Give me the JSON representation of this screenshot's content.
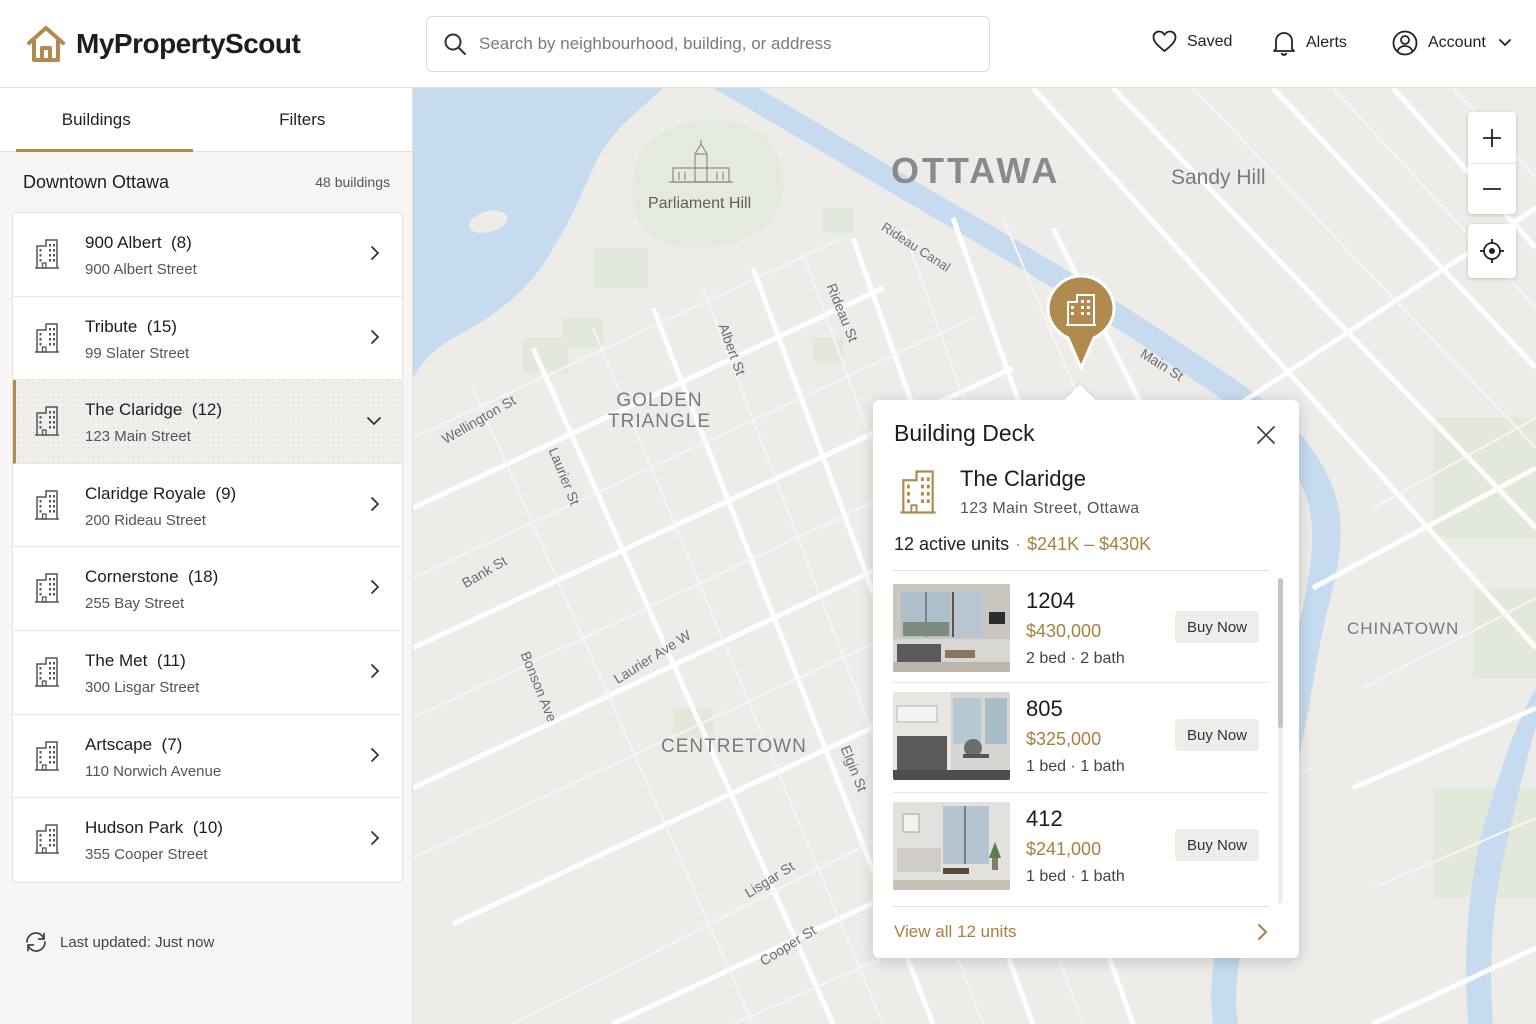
{
  "header": {
    "brand": "MyPropertyScout",
    "search_placeholder": "Search by neighbourhood, building, or address",
    "saved_label": "Saved",
    "alerts_label": "Alerts",
    "account_label": "Account"
  },
  "sidebar": {
    "tabs": [
      {
        "label": "Buildings",
        "active": true
      },
      {
        "label": "Filters",
        "active": false
      }
    ],
    "area": "Downtown Ottawa",
    "count": "48 buildings",
    "buildings": [
      {
        "name": "900 Albert",
        "units": "(8)",
        "address": "900 Albert Street"
      },
      {
        "name": "Tribute",
        "units": "(15)",
        "address": "99 Slater Street"
      },
      {
        "name": "The Claridge",
        "units": "(12)",
        "address": "123 Main Street"
      },
      {
        "name": "Claridge Royale",
        "units": "(9)",
        "address": "200 Rideau Street"
      },
      {
        "name": "Cornerstone",
        "units": "(18)",
        "address": "255 Bay Street"
      },
      {
        "name": "The Met",
        "units": "(11)",
        "address": "300 Lisgar Street"
      },
      {
        "name": "Artscape",
        "units": "(7)",
        "address": "110 Norwich Avenue"
      },
      {
        "name": "Hudson Park",
        "units": "(10)",
        "address": "355 Cooper Street"
      }
    ],
    "last_updated": "Last updated: Just now"
  },
  "map": {
    "city": "OTTAWA",
    "labels": {
      "sandy_hill": "Sandy Hill",
      "parliament": "Parliament Hill",
      "golden_triangle": "GOLDEN\nTRIANGLE",
      "centretown": "CENTRETOWN",
      "chinatown": "CHINATOWN",
      "rideau_canal": "Rideau Canal",
      "rideau_st": "Rideau St",
      "albert_st": "Albert St",
      "main_st": "Main St",
      "wellington_st": "Wellington St",
      "laurier_st": "Laurier St",
      "bank_st": "Bank St",
      "bonson_ave": "Bonson Ave",
      "laurier_ave_w": "Laurier Ave W",
      "elgin_st": "Elgin St",
      "lisgar_st": "Lisgar St",
      "cooper_st": "Cooper St"
    }
  },
  "deck": {
    "title": "Building Deck",
    "name": "The Claridge",
    "address": "123 Main Street, Ottawa",
    "active_units": "12 active units",
    "price_range": "$241K – $430K",
    "units": [
      {
        "number": "1204",
        "price": "$430,000",
        "beds": "2 bed",
        "baths": "2 bath",
        "button": "Buy Now"
      },
      {
        "number": "805",
        "price": "$325,000",
        "beds": "1 bed",
        "baths": "1 bath",
        "button": "Buy Now"
      },
      {
        "number": "412",
        "price": "$241,000",
        "beds": "1 bed",
        "baths": "1 bath",
        "button": "Buy Now"
      }
    ],
    "view_all": "View all 12 units"
  },
  "colors": {
    "accent": "#b08a4f",
    "price": "#a8803f",
    "water": "#c6dbef",
    "park": "#e2e9d8"
  }
}
